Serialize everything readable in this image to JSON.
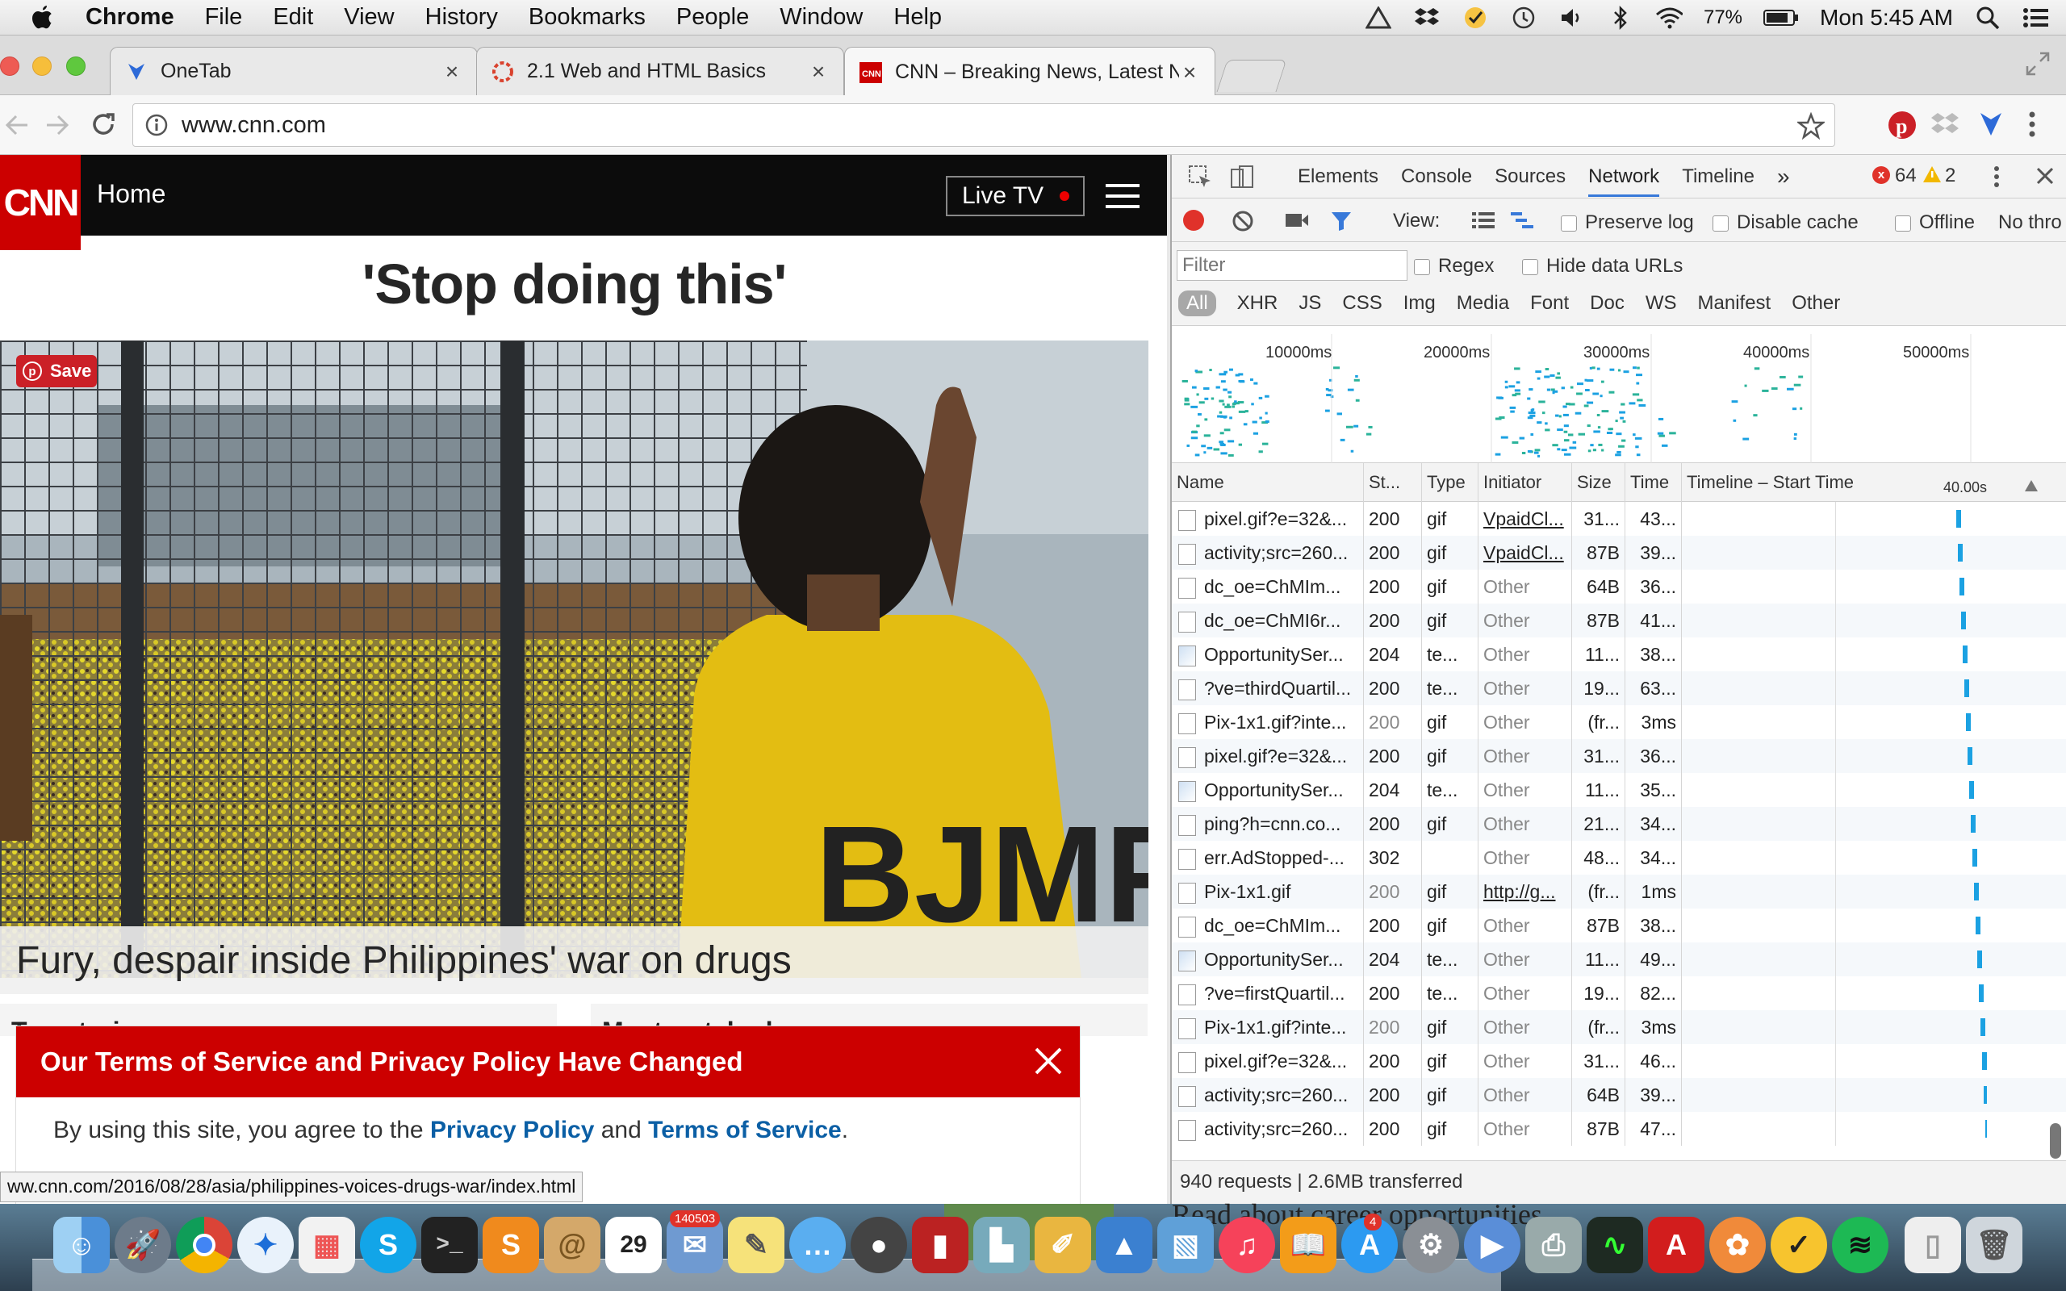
{
  "menubar": {
    "app": "Chrome",
    "items": [
      "File",
      "Edit",
      "View",
      "History",
      "Bookmarks",
      "People",
      "Window",
      "Help"
    ],
    "battery": "77%",
    "clock": "Mon 5:45 AM"
  },
  "tabs": [
    {
      "title": "OneTab"
    },
    {
      "title": "2.1 Web and HTML Basics"
    },
    {
      "title": "CNN – Breaking News, Latest N"
    }
  ],
  "omnibox": {
    "url": "www.cnn.com"
  },
  "cnn": {
    "nav_home": "Home",
    "logo": "CNN",
    "live_tv": "Live TV",
    "headline": "'Stop doing this'",
    "save_label": "Save",
    "shirt_text": "BJMP",
    "caption": "Fury, despair inside Philippines' war on drugs",
    "section_left": "Top stories",
    "section_right": "Most watched",
    "tos_title": "Our Terms of Service and Privacy Policy Have Changed",
    "tos_text_prefix": "By using this site, you agree to the ",
    "tos_privacy": "Privacy Policy",
    "tos_and": " and ",
    "tos_terms": "Terms of Service",
    "tos_period": "."
  },
  "status_url": "ww.cnn.com/2016/08/28/asia/philippines-voices-drugs-war/index.html",
  "devtools": {
    "tabs": [
      "Elements",
      "Console",
      "Sources",
      "Network",
      "Timeline"
    ],
    "active_tab": "Network",
    "errors": "64",
    "warnings": "2",
    "toolbar": {
      "view": "View:",
      "preserve": "Preserve log",
      "disable_cache": "Disable cache",
      "offline": "Offline",
      "throttle": "No thro"
    },
    "filter_placeholder": "Filter",
    "regex": "Regex",
    "hide_data": "Hide data URLs",
    "types": [
      "All",
      "XHR",
      "JS",
      "CSS",
      "Img",
      "Media",
      "Font",
      "Doc",
      "WS",
      "Manifest",
      "Other"
    ],
    "overview_ticks": [
      "10000ms",
      "20000ms",
      "30000ms",
      "40000ms",
      "50000ms"
    ],
    "columns": [
      "Name",
      "St...",
      "Type",
      "Initiator",
      "Size",
      "Time",
      "Timeline – Start Time"
    ],
    "timeline_label": "40.00s",
    "rows": [
      {
        "name": "pixel.gif?e=32&...",
        "status": "200",
        "type": "gif",
        "init": "VpaidCl...",
        "size": "31...",
        "time": "43...",
        "init_link": true
      },
      {
        "name": "activity;src=260...",
        "status": "200",
        "type": "gif",
        "init": "VpaidCl...",
        "size": "87B",
        "time": "39...",
        "init_link": true
      },
      {
        "name": "dc_oe=ChMIm...",
        "status": "200",
        "type": "gif",
        "init": "Other",
        "size": "64B",
        "time": "36..."
      },
      {
        "name": "dc_oe=ChMI6r...",
        "status": "200",
        "type": "gif",
        "init": "Other",
        "size": "87B",
        "time": "41..."
      },
      {
        "name": "OpportunitySer...",
        "status": "204",
        "type": "te...",
        "init": "Other",
        "size": "11...",
        "time": "38...",
        "doc": true
      },
      {
        "name": "?ve=thirdQuartil...",
        "status": "200",
        "type": "te...",
        "init": "Other",
        "size": "19...",
        "time": "63..."
      },
      {
        "name": "Pix-1x1.gif?inte...",
        "status": "200",
        "type": "gif",
        "init": "Other",
        "size": "(fr...",
        "time": "3ms",
        "dim": true
      },
      {
        "name": "pixel.gif?e=32&...",
        "status": "200",
        "type": "gif",
        "init": "Other",
        "size": "31...",
        "time": "36..."
      },
      {
        "name": "OpportunitySer...",
        "status": "204",
        "type": "te...",
        "init": "Other",
        "size": "11...",
        "time": "35...",
        "doc": true
      },
      {
        "name": "ping?h=cnn.co...",
        "status": "200",
        "type": "gif",
        "init": "Other",
        "size": "21...",
        "time": "34..."
      },
      {
        "name": "err.AdStopped-...",
        "status": "302",
        "type": "",
        "init": "Other",
        "size": "48...",
        "time": "34..."
      },
      {
        "name": "Pix-1x1.gif",
        "status": "200",
        "type": "gif",
        "init": "http://g...",
        "size": "(fr...",
        "time": "1ms",
        "dim": true,
        "init_link": true
      },
      {
        "name": "dc_oe=ChMIm...",
        "status": "200",
        "type": "gif",
        "init": "Other",
        "size": "87B",
        "time": "38..."
      },
      {
        "name": "OpportunitySer...",
        "status": "204",
        "type": "te...",
        "init": "Other",
        "size": "11...",
        "time": "49...",
        "doc": true
      },
      {
        "name": "?ve=firstQuartil...",
        "status": "200",
        "type": "te...",
        "init": "Other",
        "size": "19...",
        "time": "82..."
      },
      {
        "name": "Pix-1x1.gif?inte...",
        "status": "200",
        "type": "gif",
        "init": "Other",
        "size": "(fr...",
        "time": "3ms",
        "dim": true
      },
      {
        "name": "pixel.gif?e=32&...",
        "status": "200",
        "type": "gif",
        "init": "Other",
        "size": "31...",
        "time": "46..."
      },
      {
        "name": "activity;src=260...",
        "status": "200",
        "type": "gif",
        "init": "Other",
        "size": "64B",
        "time": "39..."
      },
      {
        "name": "activity;src=260...",
        "status": "200",
        "type": "gif",
        "init": "Other",
        "size": "87B",
        "time": "47..."
      }
    ],
    "summary": "940 requests | 2.6MB transferred"
  },
  "careers_text": "Read about career opportunities",
  "dock": {
    "calendar_day": "29",
    "mail_badge": "140503",
    "appstore_badge": "4"
  },
  "colors": {
    "cnn_red": "#cc0000",
    "devtools_blue": "#3879d9",
    "waterfall": "#1ba1e2"
  }
}
